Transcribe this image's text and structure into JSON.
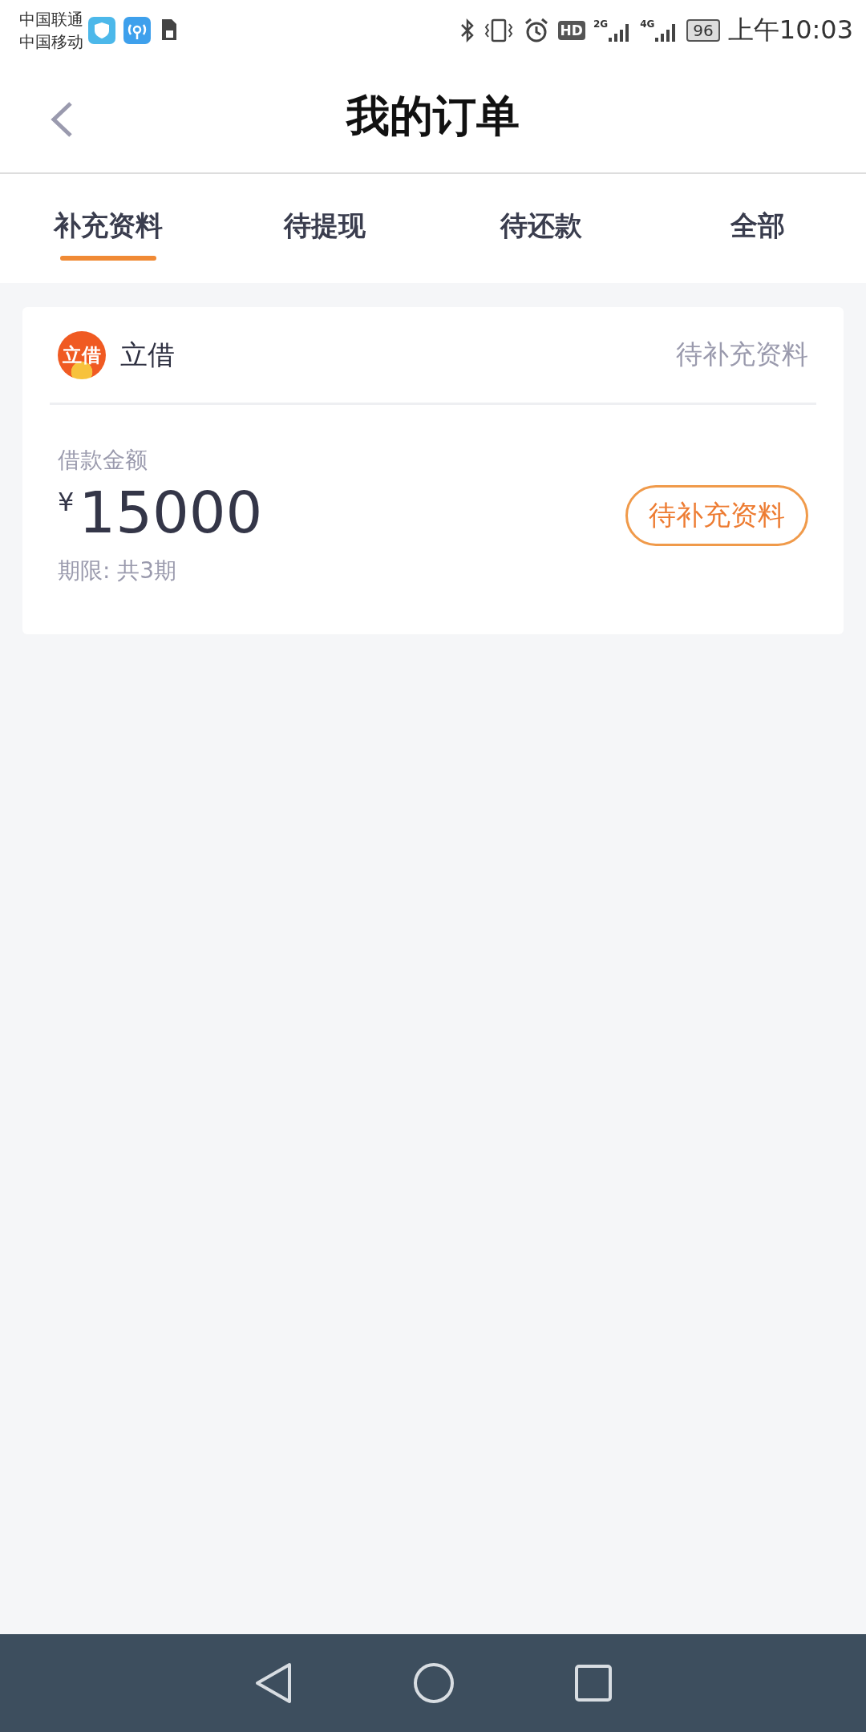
{
  "status_bar": {
    "carriers": [
      "中国联通",
      "中国移动"
    ],
    "hd": "HD",
    "net_1": "2G",
    "net_2": "4G",
    "battery": "96",
    "time": "上午10:03"
  },
  "header": {
    "title": "我的订单"
  },
  "tabs": [
    {
      "label": "补充资料",
      "selected": true
    },
    {
      "label": "待提现",
      "selected": false
    },
    {
      "label": "待还款",
      "selected": false
    },
    {
      "label": "全部",
      "selected": false
    }
  ],
  "orders": [
    {
      "logo_text": "立借",
      "name": "立借",
      "status": "待补充资料",
      "amount_label": "借款金额",
      "currency": "¥",
      "amount": "15000",
      "term": "期限: 共3期",
      "action": "待补充资料"
    }
  ]
}
